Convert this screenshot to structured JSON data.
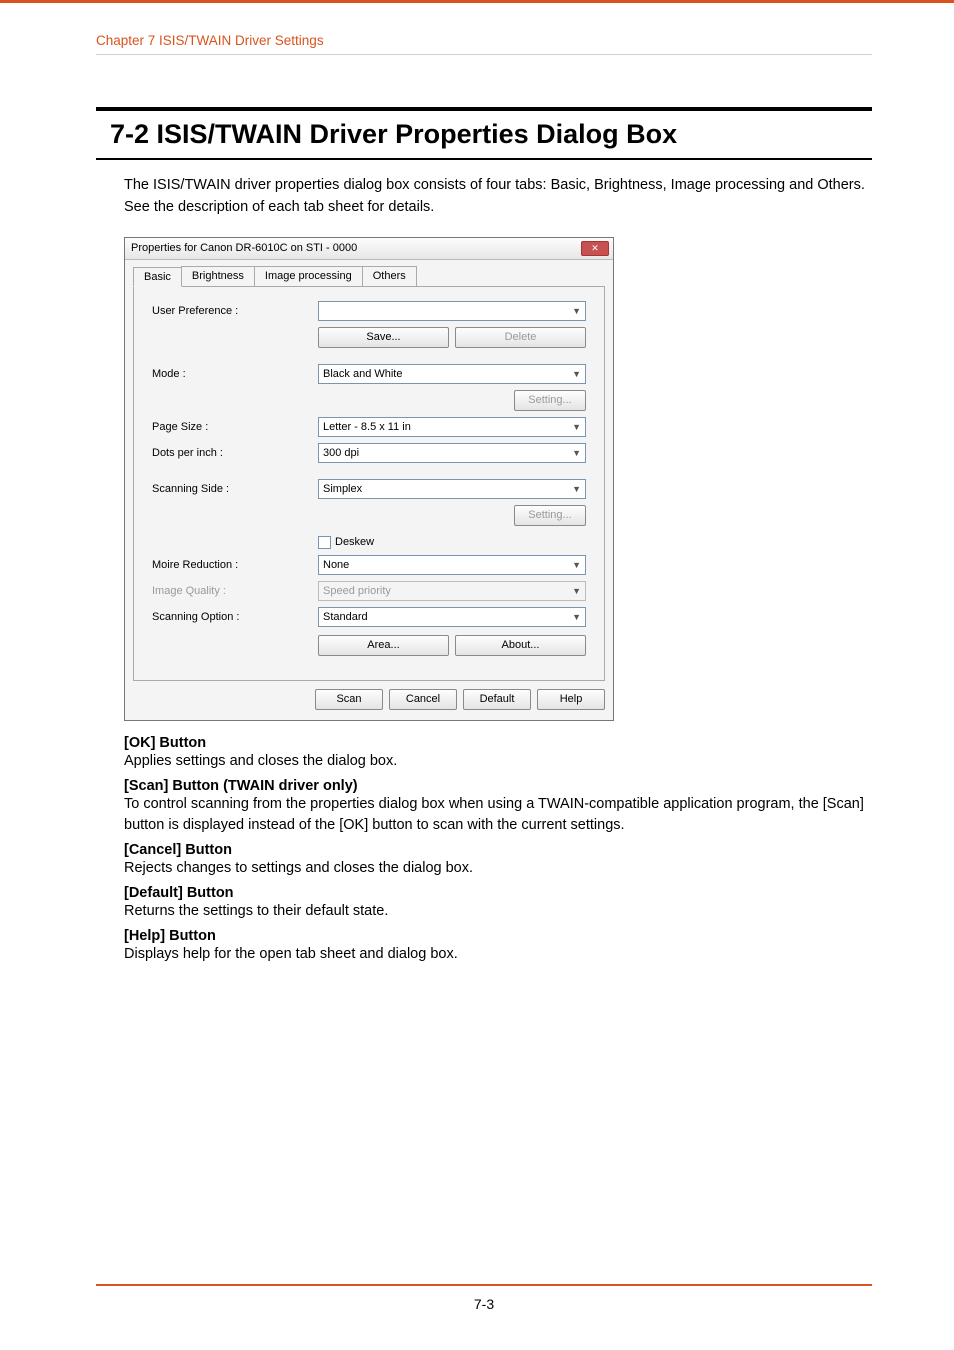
{
  "header": {
    "chapter": "Chapter 7   ISIS/TWAIN Driver Settings"
  },
  "heading": "7-2  ISIS/TWAIN Driver Properties Dialog Box",
  "intro": "The ISIS/TWAIN driver properties dialog box consists of four tabs: Basic, Brightness, Image processing and Others. See the description of each tab sheet for details.",
  "dialog": {
    "title": "Properties for Canon DR-6010C on STI - 0000",
    "tabs": [
      "Basic",
      "Brightness",
      "Image processing",
      "Others"
    ],
    "active_tab": 0,
    "labels": {
      "user_pref": "User Preference :",
      "mode": "Mode :",
      "page_size": "Page Size :",
      "dpi": "Dots per inch :",
      "scanning_side": "Scanning Side :",
      "deskew": "Deskew",
      "moire": "Moire Reduction :",
      "image_quality": "Image Quality :",
      "scanning_option": "Scanning Option :"
    },
    "values": {
      "user_pref": "",
      "mode": "Black and White",
      "page_size": "Letter - 8.5 x 11 in",
      "dpi": "300 dpi",
      "scanning_side": "Simplex",
      "deskew_checked": false,
      "moire": "None",
      "image_quality": "Speed priority",
      "scanning_option": "Standard"
    },
    "buttons": {
      "save": "Save...",
      "delete": "Delete",
      "setting": "Setting...",
      "area": "Area...",
      "about": "About...",
      "scan": "Scan",
      "cancel": "Cancel",
      "default": "Default",
      "help": "Help"
    }
  },
  "definitions": [
    {
      "title": "[OK] Button",
      "body": "Applies settings and closes the dialog box."
    },
    {
      "title": "[Scan] Button (TWAIN driver only)",
      "body": "To control scanning from the properties dialog box when using a TWAIN-compatible application program, the [Scan] button is displayed instead of the [OK] button to scan with the current settings."
    },
    {
      "title": "[Cancel] Button",
      "body": "Rejects changes to settings and closes the dialog box."
    },
    {
      "title": "[Default] Button",
      "body": "Returns the settings to their default state."
    },
    {
      "title": "[Help] Button",
      "body": "Displays help for the open tab sheet and dialog box."
    }
  ],
  "footer": {
    "page": "7-3"
  }
}
